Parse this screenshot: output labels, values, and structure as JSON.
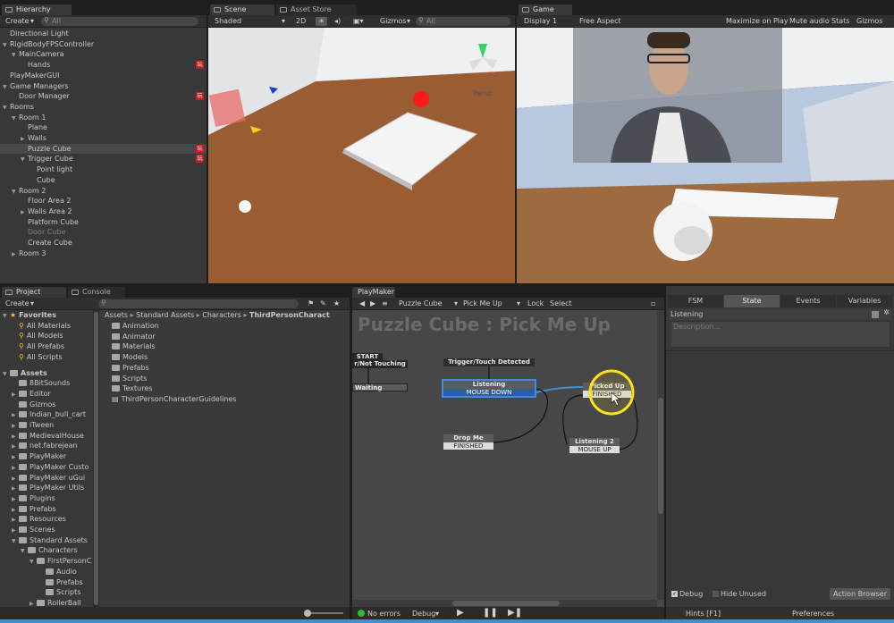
{
  "hierarchy": {
    "tab": "Hierarchy",
    "create": "Create",
    "search_placeholder": "All",
    "items": [
      {
        "label": "Directional Light",
        "indent": 0,
        "arrow": "",
        "badge": false
      },
      {
        "label": "RigidBodyFPSController",
        "indent": 0,
        "arrow": "▼",
        "badge": false
      },
      {
        "label": "MainCamera",
        "indent": 1,
        "arrow": "▼",
        "badge": false
      },
      {
        "label": "Hands",
        "indent": 2,
        "arrow": "",
        "badge": true
      },
      {
        "label": "PlayMakerGUI",
        "indent": 0,
        "arrow": "",
        "badge": false
      },
      {
        "label": "Game Managers",
        "indent": 0,
        "arrow": "▼",
        "badge": false
      },
      {
        "label": "Door Manager",
        "indent": 1,
        "arrow": "",
        "badge": true
      },
      {
        "label": "Rooms",
        "indent": 0,
        "arrow": "▼",
        "badge": false
      },
      {
        "label": "Room 1",
        "indent": 1,
        "arrow": "▼",
        "badge": false
      },
      {
        "label": "Plane",
        "indent": 2,
        "arrow": "",
        "badge": false
      },
      {
        "label": "Walls",
        "indent": 2,
        "arrow": "▶",
        "badge": false
      },
      {
        "label": "Puzzle Cube",
        "indent": 2,
        "arrow": "",
        "badge": true,
        "selected": true
      },
      {
        "label": "Trigger Cube",
        "indent": 2,
        "arrow": "▼",
        "badge": true
      },
      {
        "label": "Point light",
        "indent": 3,
        "arrow": "",
        "badge": false
      },
      {
        "label": "Cube",
        "indent": 3,
        "arrow": "",
        "badge": false
      },
      {
        "label": "Room 2",
        "indent": 1,
        "arrow": "▼",
        "badge": false
      },
      {
        "label": "Floor Area 2",
        "indent": 2,
        "arrow": "",
        "badge": false
      },
      {
        "label": "Walls Area 2",
        "indent": 2,
        "arrow": "▶",
        "badge": false
      },
      {
        "label": "Platform Cube",
        "indent": 2,
        "arrow": "",
        "badge": false
      },
      {
        "label": "Door Cube",
        "indent": 2,
        "arrow": "",
        "badge": false,
        "dim": true
      },
      {
        "label": "Create Cube",
        "indent": 2,
        "arrow": "",
        "badge": false
      },
      {
        "label": "Room 3",
        "indent": 1,
        "arrow": "▶",
        "badge": false
      }
    ]
  },
  "scene": {
    "tabs": [
      "Scene",
      "Asset Store"
    ],
    "shading": "Shaded",
    "mode_2d": "2D",
    "gizmos": "Gizmos",
    "search_placeholder": "All",
    "persp_label": "Persp"
  },
  "game": {
    "tab": "Game",
    "display": "Display 1",
    "aspect": "Free Aspect",
    "options": [
      "Maximize on Play",
      "Mute audio",
      "Stats",
      "Gizmos"
    ]
  },
  "project": {
    "tabs": [
      "Project",
      "Console"
    ],
    "create": "Create",
    "favorites_label": "Favorites",
    "favorites": [
      "All Materials",
      "All Models",
      "All Prefabs",
      "All Scripts"
    ],
    "assets_label": "Assets",
    "tree": [
      {
        "label": "8BitSounds",
        "indent": 1,
        "arrow": ""
      },
      {
        "label": "Editor",
        "indent": 1,
        "arrow": "▶"
      },
      {
        "label": "Gizmos",
        "indent": 1,
        "arrow": ""
      },
      {
        "label": "Indian_bull_cart",
        "indent": 1,
        "arrow": "▶"
      },
      {
        "label": "iTween",
        "indent": 1,
        "arrow": "▶"
      },
      {
        "label": "MedievalHouse",
        "indent": 1,
        "arrow": "▶"
      },
      {
        "label": "net.fabrejean",
        "indent": 1,
        "arrow": "▶"
      },
      {
        "label": "PlayMaker",
        "indent": 1,
        "arrow": "▶"
      },
      {
        "label": "PlayMaker Custo",
        "indent": 1,
        "arrow": "▶"
      },
      {
        "label": "PlayMaker uGui",
        "indent": 1,
        "arrow": "▶"
      },
      {
        "label": "PlayMaker Utils",
        "indent": 1,
        "arrow": "▶"
      },
      {
        "label": "Plugins",
        "indent": 1,
        "arrow": "▶"
      },
      {
        "label": "Prefabs",
        "indent": 1,
        "arrow": "▶"
      },
      {
        "label": "Resources",
        "indent": 1,
        "arrow": "▶"
      },
      {
        "label": "Scenes",
        "indent": 1,
        "arrow": "▶"
      },
      {
        "label": "Standard Assets",
        "indent": 1,
        "arrow": "▼"
      },
      {
        "label": "Characters",
        "indent": 2,
        "arrow": "▼"
      },
      {
        "label": "FirstPersonC",
        "indent": 3,
        "arrow": "▼"
      },
      {
        "label": "Audio",
        "indent": 4,
        "arrow": ""
      },
      {
        "label": "Prefabs",
        "indent": 4,
        "arrow": ""
      },
      {
        "label": "Scripts",
        "indent": 4,
        "arrow": ""
      },
      {
        "label": "RollerBall",
        "indent": 3,
        "arrow": "▶"
      },
      {
        "label": "ThirdPerson",
        "indent": 3,
        "arrow": "▶",
        "selected": true
      }
    ],
    "breadcrumb": [
      "Assets",
      "Standard Assets",
      "Characters",
      "ThirdPersonCharact"
    ],
    "files": [
      "Animation",
      "Animator",
      "Materials",
      "Models",
      "Prefabs",
      "Scripts",
      "Textures",
      "ThirdPersonCharacterGuidelines"
    ]
  },
  "playmaker": {
    "tab": "PlayMaker",
    "object": "Puzzle Cube",
    "fsm": "Pick Me Up",
    "lock": "Lock",
    "select": "Select",
    "graph_title": "Puzzle Cube : Pick Me Up",
    "start_label": "START",
    "start_event": "r/Not Touching",
    "waiting": "Waiting",
    "global_event": "Trigger/Touch Detected",
    "states": {
      "listening": {
        "title": "Listening",
        "event": "MOUSE DOWN"
      },
      "picked_up": {
        "title": "Picked Up",
        "event": "FINISHED"
      },
      "drop_me": {
        "title": "Drop Me",
        "event": "FINISHED"
      },
      "listening2": {
        "title": "Listening 2",
        "event": "MOUSE UP"
      }
    },
    "status": {
      "errors": "No errors",
      "debug": "Debug"
    }
  },
  "inspector": {
    "tabs": [
      "FSM",
      "State",
      "Events",
      "Variables"
    ],
    "active_tab": "State",
    "state_name": "Listening",
    "description_placeholder": "Description...",
    "debug": "Debug",
    "hide_unused": "Hide Unused",
    "action_browser": "Action Browser",
    "hints": "Hints [F1]",
    "preferences": "Preferences"
  },
  "colors": {
    "accent": "#3f8fd8",
    "pm_badge": "#c02020",
    "selected_state": "#2a5db0",
    "cursor_ring": "#ffe21a"
  }
}
